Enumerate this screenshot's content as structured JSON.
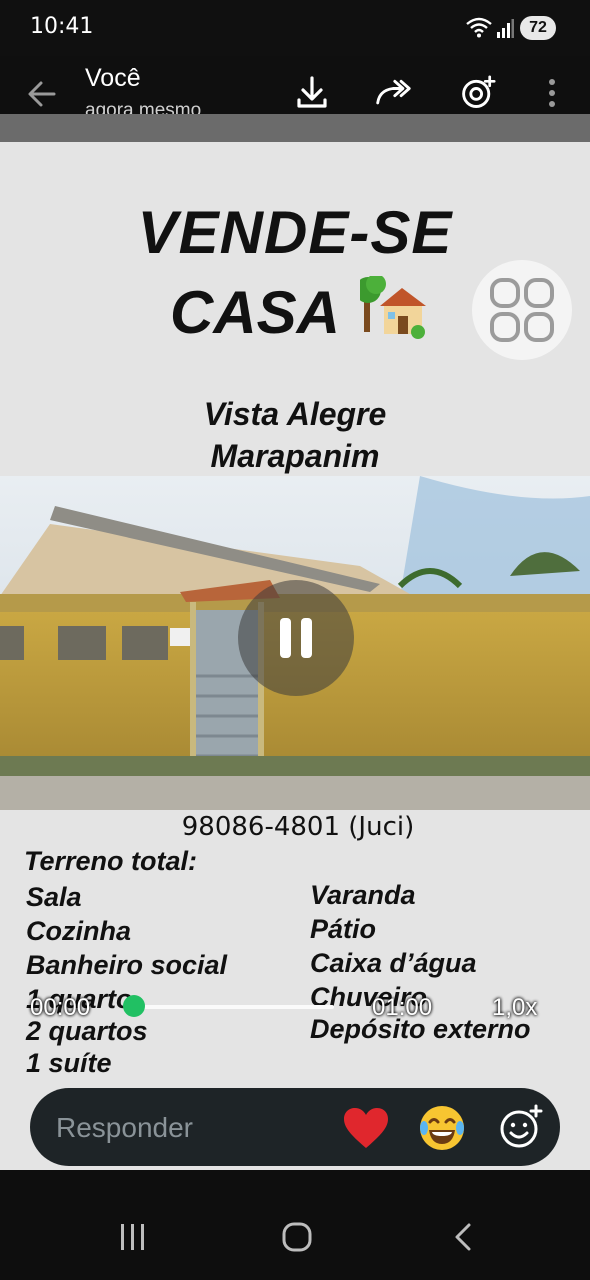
{
  "status_bar": {
    "time": "10:41",
    "battery": "72"
  },
  "header": {
    "sender": "Você",
    "subtitle": "agora mesmo"
  },
  "post": {
    "headline_line1": "VENDE-SE",
    "headline_line2": "CASA",
    "location_line1": "Vista Alegre",
    "location_line2": "Marapanim",
    "phone": "98086-4801 (Juci)",
    "terreno_label": "Terreno total:",
    "features_left": [
      "Sala",
      "Cozinha",
      "Banheiro social",
      "1 quarto",
      "2 quartos",
      "1 suíte"
    ],
    "features_right": [
      "Varanda",
      "Pátio",
      "Caixa d’água",
      "Chuveiro",
      "Depósito externo"
    ]
  },
  "player": {
    "current_time": "00:00",
    "total_time": "01:00",
    "speed": "1,0x",
    "progress": 0.0
  },
  "reply": {
    "placeholder": "Responder"
  },
  "icons": [
    "back-icon",
    "download-icon",
    "forward-icon",
    "reaction-add-icon",
    "more-icon",
    "grid-icon",
    "pause-icon",
    "heart-icon",
    "laugh-icon",
    "emoji-add-icon"
  ],
  "colors": {
    "accent": "#21c063",
    "reply_bar": "#1e2427",
    "poster_bg": "#e4e4e4"
  }
}
